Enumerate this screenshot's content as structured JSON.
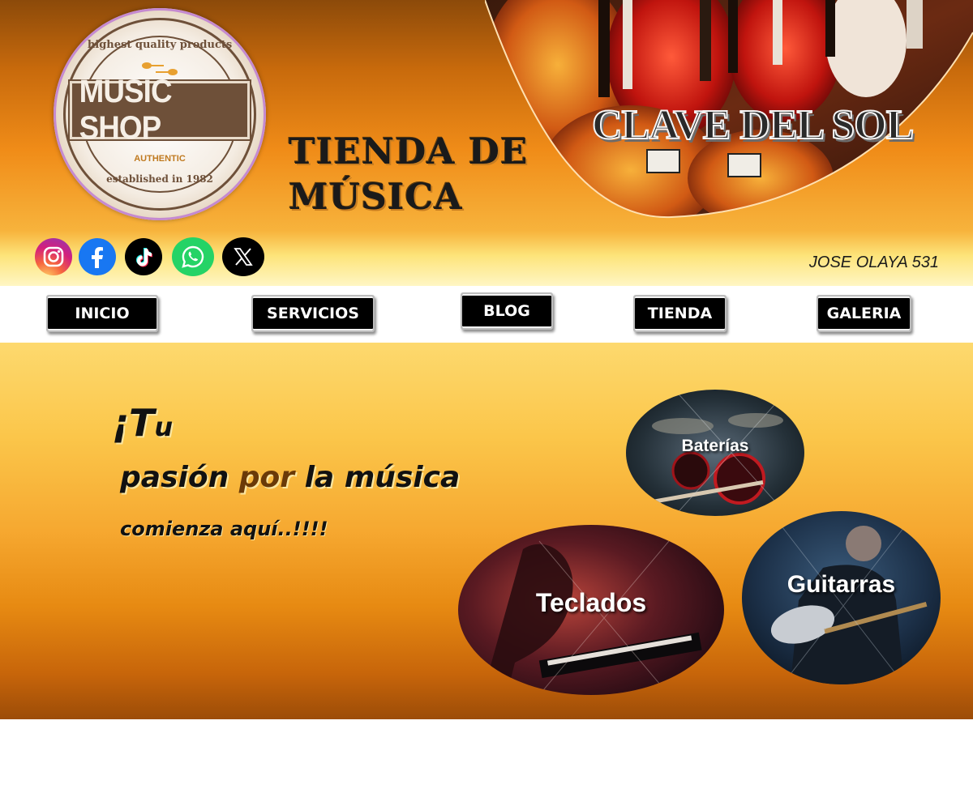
{
  "logo": {
    "top_text": "highest quality products",
    "name": "MUSIC SHOP",
    "badge": "AUTHENTIC",
    "established": "established in 1982"
  },
  "header": {
    "title_line1": "TIENDA DE",
    "title_line2": "MÚSICA",
    "brand": "CLAVE DEL SOL"
  },
  "social": {
    "icons": [
      "instagram-icon",
      "facebook-icon",
      "tiktok-icon",
      "whatsapp-icon",
      "x-icon"
    ],
    "address": "JOSE OLAYA 531"
  },
  "nav": {
    "items": [
      "INICIO",
      "SERVICIOS",
      "BLOG",
      "TIENDA",
      "GALERIA"
    ]
  },
  "hero": {
    "line1_mark": "¡",
    "line1_big": "T",
    "line1_small": "u",
    "line2_a": "pasión",
    "line2_b": "por",
    "line2_c": "la música",
    "line3": "comienza aquí..!!!!"
  },
  "categories": [
    "Baterías",
    "Teclados",
    "Guitarras"
  ],
  "colors": {
    "accent": "#f08c18",
    "brand_brown": "#6e5039",
    "nav_bg": "#000000"
  }
}
